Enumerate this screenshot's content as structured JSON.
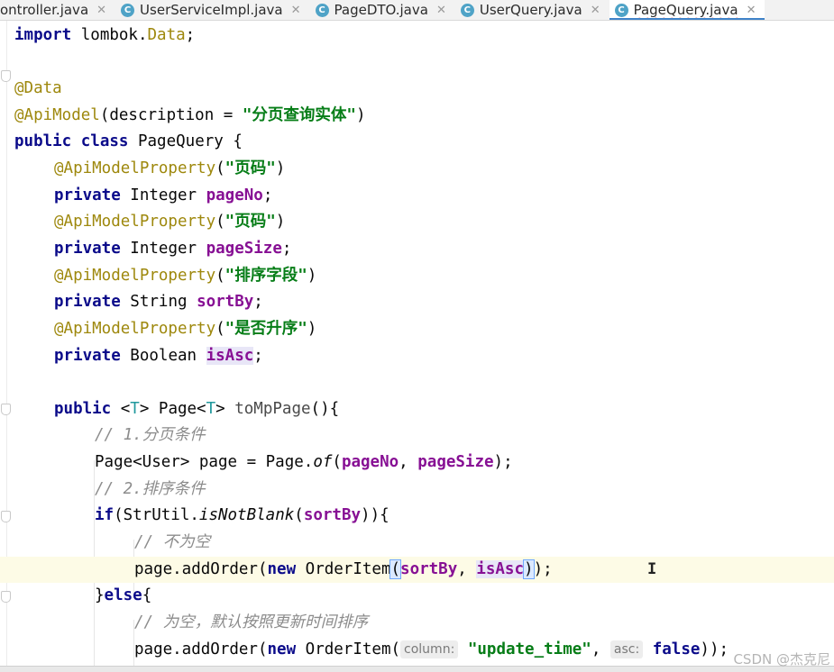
{
  "tabs": [
    {
      "label": "ontroller.java",
      "icon": "java-class-icon",
      "active": false
    },
    {
      "label": "UserServiceImpl.java",
      "icon": "java-class-icon",
      "active": false
    },
    {
      "label": "PageDTO.java",
      "icon": "java-class-icon",
      "active": false
    },
    {
      "label": "UserQuery.java",
      "icon": "java-class-icon",
      "active": false
    },
    {
      "label": "PageQuery.java",
      "icon": "java-class-icon",
      "active": true
    }
  ],
  "code": {
    "import_kw": "import",
    "import_pkg": " lombok.",
    "import_cls": "Data",
    "import_end": ";",
    "anno_data": "@Data",
    "anno_apimodel": "@ApiModel",
    "apimodel_args": "(description = ",
    "apimodel_str": "\"分页查询实体\"",
    "apimodel_end": ")",
    "class_kw": "public class",
    "class_name": " PageQuery {",
    "prop_anno": "@ApiModelProperty",
    "p1_desc": "\"页码\"",
    "p2_desc": "\"页码\"",
    "p3_desc": "\"排序字段\"",
    "p4_desc": "\"是否升序\"",
    "private_kw": "private",
    "f1_type": " Integer ",
    "f1_name": "pageNo",
    "f2_type": " Integer ",
    "f2_name": "pageSize",
    "f3_type": " String ",
    "f3_name": "sortBy",
    "f4_type": " Boolean ",
    "f4_name": "isAsc",
    "semicolon": ";",
    "method_kw": "public",
    "method_tp_open": " <",
    "method_tp": "T",
    "method_tp_close": "> Page<",
    "method_tp2": "T",
    "method_tp2_close": "> ",
    "method_name": "toMpPage",
    "method_end": "(){",
    "comment1": "// 1.分页条件",
    "page_decl": "Page<User> page = Page.",
    "page_of": "of",
    "page_open": "(",
    "page_arg1": "pageNo",
    "page_sep": ", ",
    "page_arg2": "pageSize",
    "page_close": ");",
    "comment2": "// 2.排序条件",
    "if_kw": "if",
    "if_open": "(StrUtil.",
    "if_method": "isNotBlank",
    "if_paren": "(",
    "if_arg": "sortBy",
    "if_end": ")){",
    "comment3": "// 不为空",
    "add1_pre": "page.addOrder(",
    "new_kw": "new",
    "add1_cls": " OrderItem",
    "add1_open": "(",
    "add1_arg1": "sortBy",
    "add1_sep": ", ",
    "add1_arg2": "isAsc",
    "add1_close": ")",
    "add1_end": ");",
    "else_open": "}",
    "else_kw": "else",
    "else_close": "{",
    "comment4": "// 为空，默认按照更新时间排序",
    "add2_pre": "page.addOrder(",
    "add2_cls": " OrderItem(",
    "hint_column": "column:",
    "add2_str": "\"update_time\"",
    "add2_sep": ", ",
    "hint_asc": "asc:",
    "false_kw": "false",
    "add2_end": "));"
  },
  "watermark": "CSDN @杰克尼"
}
